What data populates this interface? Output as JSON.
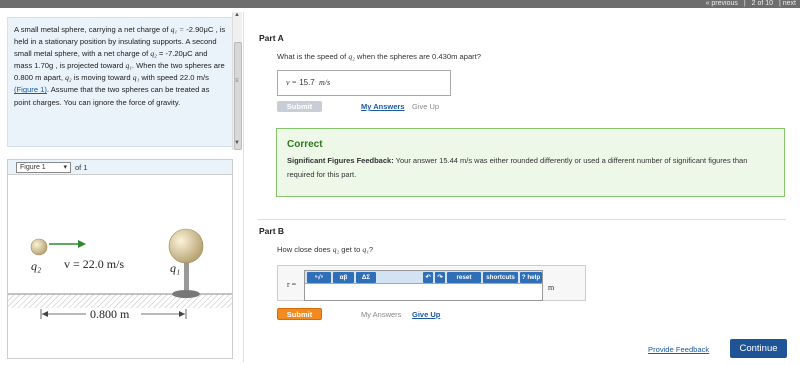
{
  "nav": {
    "previous": "« previous",
    "page": "2 of 10",
    "next": "next"
  },
  "problem": {
    "text_parts": [
      "A small metal sphere, carrying a net charge of",
      "q₁ =",
      "-2.90μC , is held in a stationary position by insulating supports. A second small metal sphere, with a net charge of",
      "q₂",
      "= -7.20μC and mass 1.70g , is projected toward",
      "q₁",
      ". When the two spheres are 0.800 m apart,",
      "q₂",
      "is moving toward",
      "q₁",
      "with speed 22.0 m/s",
      ". Assume that the two spheres can be treated as point charges. You can ignore the force of gravity."
    ],
    "figure_link": "(Figure 1)"
  },
  "figure": {
    "label": "Figure 1",
    "of": "of 1",
    "q2": "q₂",
    "q1": "q₁",
    "v_label": "v = 22.0 m/s",
    "distance": "0.800 m"
  },
  "part_a": {
    "header": "Part A",
    "question_pre": "What is the speed of",
    "question_var": "q₂",
    "question_post": "when the spheres are 0.430m apart?",
    "answer_label": "v =",
    "answer_value": "15.7",
    "answer_unit": "m/s",
    "submit": "Submit",
    "my_answers": "My Answers",
    "give_up": "Give Up",
    "feedback_title": "Correct",
    "feedback_bold": "Significant Figures Feedback:",
    "feedback_text": "Your answer 15.44 m/s was either rounded differently or used a different number of significant figures than required for this part."
  },
  "part_b": {
    "header": "Part B",
    "question_pre": "How close does",
    "question_var1": "q₂",
    "question_mid": "get to",
    "question_var2": "q₁",
    "question_post": "?",
    "answer_label": "r =",
    "unit": "m",
    "submit": "Submit",
    "my_answers": "My Answers",
    "give_up": "Give Up",
    "toolbar": [
      "ⁿ√ⁿ",
      "αβ",
      "ΔΣ",
      "↶",
      "↷",
      "reset",
      "shortcuts",
      "? help"
    ]
  },
  "footer": {
    "provide_feedback": "Provide Feedback",
    "continue": "Continue"
  },
  "colors": {
    "submit": "#f28a20",
    "continue": "#1f5596",
    "correct_bg": "#edf8e8",
    "correct_title": "#2f7a1c",
    "link": "#1a5aa6"
  }
}
